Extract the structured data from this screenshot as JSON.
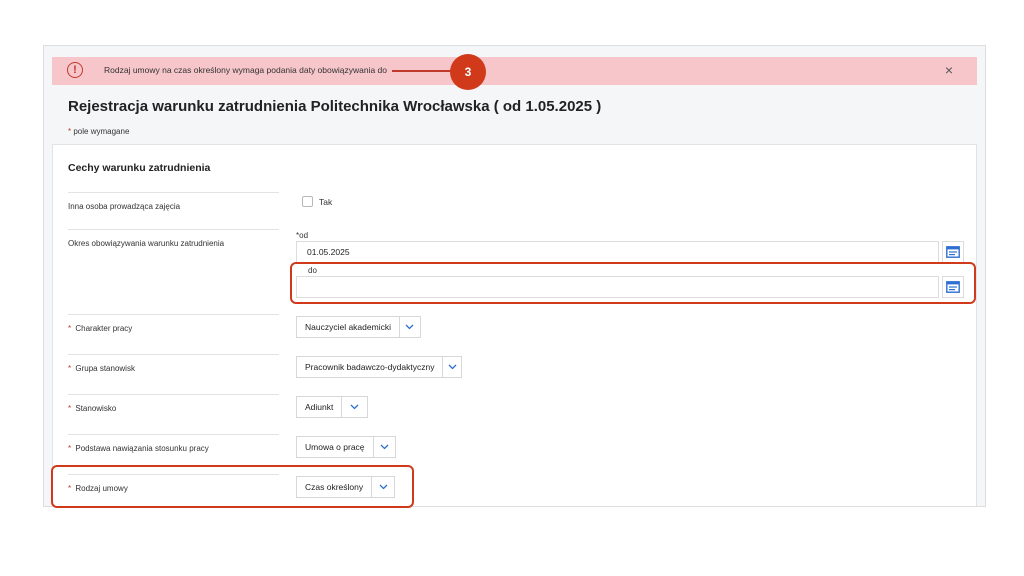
{
  "alert": {
    "icon": "error-circle-icon",
    "text": "Rodzaj umowy na czas określony wymaga podania daty obowiązywania do",
    "badge": "3",
    "close": "×"
  },
  "page": {
    "title": "Rejestracja warunku zatrudnienia Politechnika Wrocławska ( od 1.05.2025 )",
    "required_star": "*",
    "required_note": "pole wymagane"
  },
  "section": {
    "title": "Cechy warunku zatrudnienia",
    "rows": [
      {
        "label": "Inna osoba prowadząca zajęcia",
        "required": false,
        "checkbox_label": "Tak",
        "checked": false
      },
      {
        "label": "Okres obowiązywania warunku zatrudnienia",
        "required": false,
        "from_label": "*od",
        "from_value": "01.05.2025",
        "to_label": "do",
        "to_value": ""
      },
      {
        "label": "Charakter pracy",
        "required": true,
        "value": "Nauczyciel akademicki"
      },
      {
        "label": "Grupa stanowisk",
        "required": true,
        "value": "Pracownik badawczo-dydaktyczny"
      },
      {
        "label": "Stanowisko",
        "required": true,
        "value": "Adiunkt"
      },
      {
        "label": "Podstawa nawiązania stosunku pracy",
        "required": true,
        "value": "Umowa o pracę"
      },
      {
        "label": "Rodzaj umowy",
        "required": true,
        "value": "Czas określony"
      }
    ]
  },
  "colors": {
    "accent": "#d03a1b",
    "alert_bg": "#f6c6cb",
    "icon_blue": "#2f6fd1"
  }
}
